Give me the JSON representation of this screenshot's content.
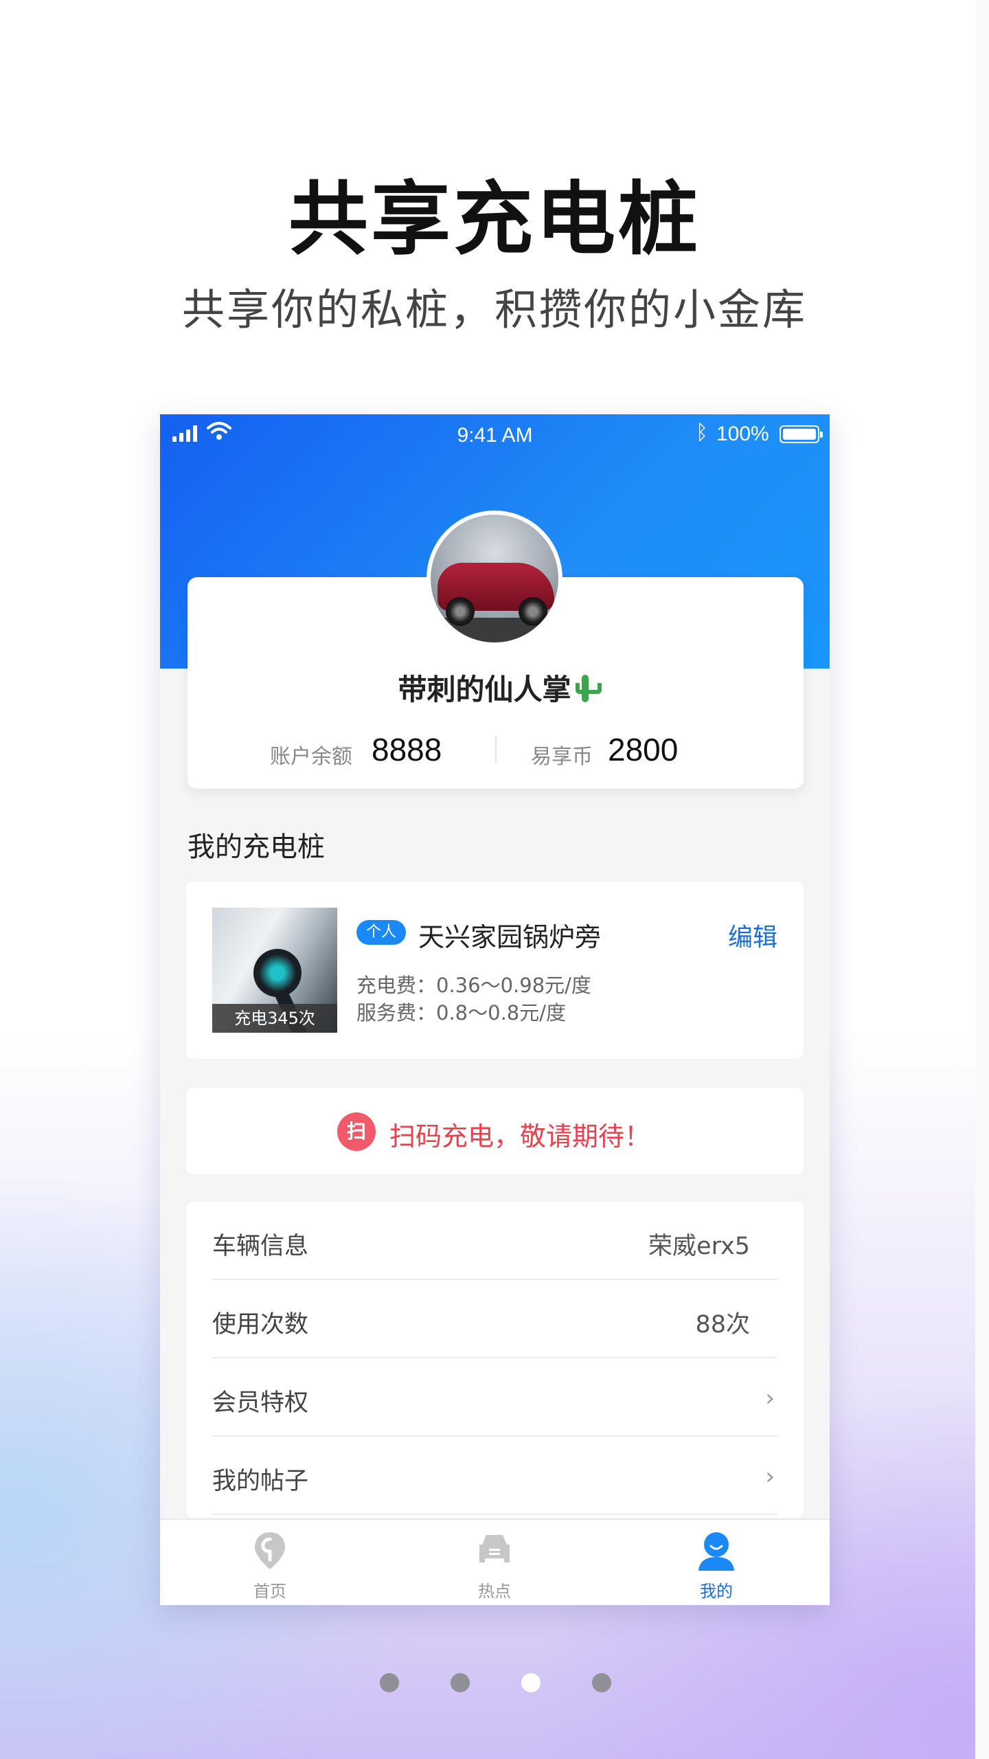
{
  "promo": {
    "title": "共享充电桩",
    "subtitle": "共享你的私桩，积攒你的小金库"
  },
  "status_bar": {
    "time": "9:41 AM",
    "battery": "100%",
    "icons": [
      "signal-icon",
      "wifi-icon",
      "bluetooth-icon",
      "battery-icon"
    ]
  },
  "profile": {
    "username": "带刺的仙人掌",
    "username_emoji": "cactus-icon",
    "balance_label": "账户余额",
    "balance_value": "8888",
    "coin_label": "易享币",
    "coin_value": "2800"
  },
  "section": {
    "my_piles_title": "我的充电桩"
  },
  "pile": {
    "tag": "个人",
    "name": "天兴家园锅炉旁",
    "edit_label": "编辑",
    "charge_fee": "充电费：0.36～0.98元/度",
    "service_fee": "服务费：0.8～0.8元/度",
    "charge_count": "充电345次"
  },
  "scan": {
    "icon_text": "扫",
    "text": "扫码充电，敬请期待！"
  },
  "info_list": [
    {
      "label": "车辆信息",
      "value": "荣威erx5",
      "chevron": false
    },
    {
      "label": "使用次数",
      "value": "88次",
      "chevron": false
    },
    {
      "label": "会员特权",
      "value": "",
      "chevron": true
    },
    {
      "label": "我的帖子",
      "value": "",
      "chevron": true
    }
  ],
  "tabs": [
    {
      "label": "首页",
      "icon": "home-pin-icon",
      "active": false
    },
    {
      "label": "热点",
      "icon": "car-icon",
      "active": false
    },
    {
      "label": "我的",
      "icon": "user-icon",
      "active": true
    }
  ],
  "colors": {
    "accent": "#1a6ed8",
    "header_gradient_start": "#1560f0",
    "header_gradient_end": "#1a96fb",
    "alert_red": "#e8424f"
  },
  "pagination": {
    "total": 4,
    "active_index": 2
  }
}
